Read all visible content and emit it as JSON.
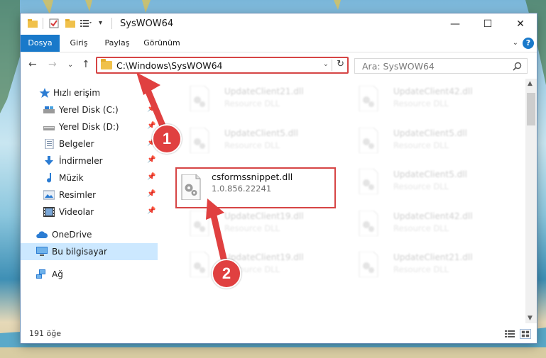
{
  "window": {
    "title": "SysWOW64",
    "controls": {
      "minimize": "—",
      "maximize": "☐",
      "close": "✕"
    }
  },
  "ribbon": {
    "tabs": [
      "Dosya",
      "Giriş",
      "Paylaş",
      "Görünüm"
    ],
    "help": "?"
  },
  "nav": {
    "address": "C:\\Windows\\SysWOW64",
    "search_placeholder": "Ara: SysWOW64"
  },
  "sidebar": {
    "items": [
      {
        "label": "Hızlı erişim",
        "icon": "star-icon"
      },
      {
        "label": "Yerel Disk (C:)",
        "icon": "drive-icon"
      },
      {
        "label": "Yerel Disk (D:)",
        "icon": "drive-icon"
      },
      {
        "label": "Belgeler",
        "icon": "documents-icon"
      },
      {
        "label": "İndirmeler",
        "icon": "download-icon"
      },
      {
        "label": "Müzik",
        "icon": "music-icon"
      },
      {
        "label": "Resimler",
        "icon": "pictures-icon"
      },
      {
        "label": "Videolar",
        "icon": "video-icon"
      },
      {
        "label": "OneDrive",
        "icon": "cloud-icon"
      },
      {
        "label": "Bu bilgisayar",
        "icon": "computer-icon"
      },
      {
        "label": "Ağ",
        "icon": "network-icon"
      }
    ]
  },
  "files": {
    "left": [
      {
        "name": "UpdateClient21.dll",
        "sub": "Resource DLL"
      },
      {
        "name": "UpdateClient5.dll",
        "sub": "Resource DLL"
      },
      {
        "name": "csformssnippet.dll",
        "sub": "1.0.856.22241"
      },
      {
        "name": "UpdateClient19.dll",
        "sub": "Resource DLL"
      },
      {
        "name": "UpdateClient19.dll",
        "sub": "Resource DLL"
      }
    ],
    "right": [
      {
        "name": "UpdateClient42.dll",
        "sub": "Resource DLL"
      },
      {
        "name": "UpdateClient5.dll",
        "sub": "Resource DLL"
      },
      {
        "name": "UpdateClient5.dll",
        "sub": "Resource DLL"
      },
      {
        "name": "UpdateClient42.dll",
        "sub": "Resource DLL"
      },
      {
        "name": "UpdateClient21.dll",
        "sub": "Resource DLL"
      }
    ]
  },
  "status": {
    "count": "191 öğe"
  },
  "callouts": [
    "1",
    "2"
  ],
  "colors": {
    "accent": "#1979ca",
    "highlight": "#d64545",
    "selected": "#cce8ff"
  }
}
